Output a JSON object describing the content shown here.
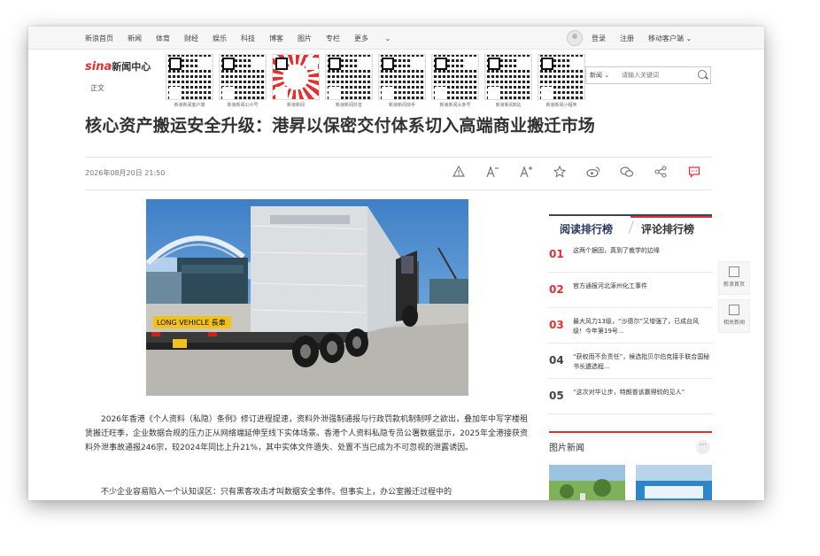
{
  "topnav": {
    "links": [
      "新浪首页",
      "新闻",
      "体育",
      "财经",
      "娱乐",
      "科技",
      "博客",
      "图片",
      "专栏",
      "更多"
    ],
    "login": "登录",
    "register": "注册",
    "mobile": "移动客户端"
  },
  "header": {
    "logo_brand": "sina",
    "logo_text": "新闻中心",
    "subtitle": "正文",
    "qr_captions": [
      "新浪新闻客户端",
      "新浪新闻公众号",
      "新浪新闻",
      "新浪新闻抖音",
      "新浪新闻快手",
      "新浪新闻头条号",
      "新浪新闻B站",
      "新浪新闻小程序"
    ],
    "search_scope": "新闻",
    "search_placeholder": "请输入关键词"
  },
  "article": {
    "title": "核心资产搬运安全升级：港昇以保密交付体系切入高端商业搬迁市场",
    "date": "2026年08月20日 21:50",
    "truck_sign": "LONG VEHICLE 長車",
    "paragraph1": "2026年香港《个人资料（私隐）条例》修订进程提速，资料外泄强制通报与行政罚款机制制呼之欲出，叠加年中写字楼租赁搬迁旺季，企业数据合规的压力正从网络端延伸至线下实体场景。香港个人资料私隐专员公署数据显示，2025年全港接获资料外泄事故通报246宗，较2024年同比上升21%，其中实体文件遗失、处置不当已成为不可忽视的泄露诱因。",
    "paragraph2": "不少企业容易陷入一个认知误区：只有黑客攻击才叫数据安全事件。但事实上，办公室搬迁过程中的"
  },
  "rank": {
    "tab_read": "阅读排行榜",
    "tab_comment": "评论排行榜",
    "items": [
      {
        "num": "01",
        "text": "这两个据固，真到了裁学的边缘"
      },
      {
        "num": "02",
        "text": "官方通报河北涿州化工事件"
      },
      {
        "num": "03",
        "text": "最大风力13级，“沙德尔”又增强了，已成台风级！今年第19号..."
      },
      {
        "num": "04",
        "text": "“获权而不负责任”，候选批贝尔伯克接手联合国秘书长遴选程..."
      },
      {
        "num": "05",
        "text": "“这次对华让步，特朗普该赢得较的见人”"
      }
    ]
  },
  "pics": {
    "heading": "图片新闻",
    "more": "···"
  },
  "float": {
    "home": "新浪首页",
    "related": "相关新闻"
  },
  "colors": {
    "accent_red": "#e62e2e",
    "navy": "#2c3a60"
  }
}
